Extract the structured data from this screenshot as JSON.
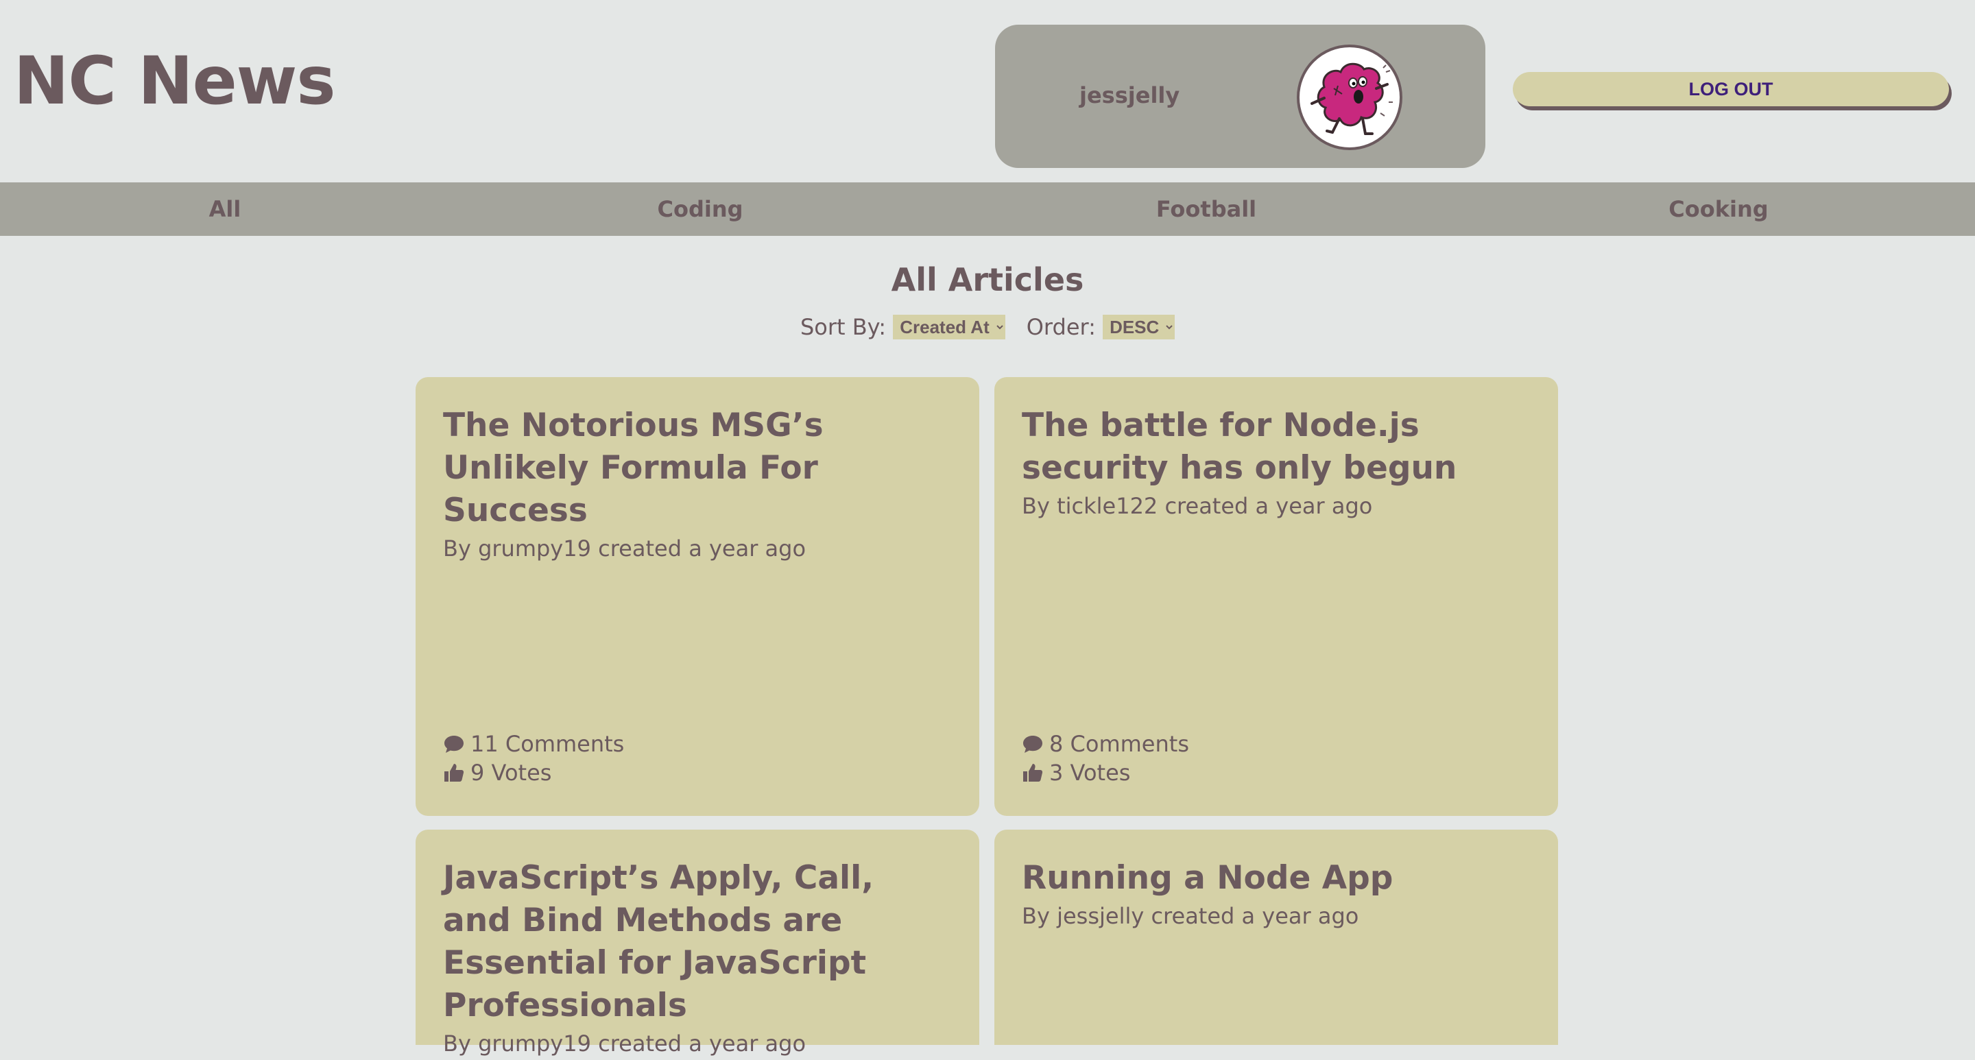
{
  "header": {
    "title": "NC News",
    "username": "jessjelly",
    "avatar_icon": "pink-monster-avatar-icon",
    "logout_label": "LOG OUT"
  },
  "nav": {
    "items": [
      {
        "label": "All"
      },
      {
        "label": "Coding"
      },
      {
        "label": "Football"
      },
      {
        "label": "Cooking"
      }
    ]
  },
  "main": {
    "heading": "All Articles",
    "sort_label": "Sort By:",
    "sort_value": "Created At",
    "order_label": "Order:",
    "order_value": "DESC"
  },
  "articles": [
    {
      "title": "The Notorious MSG’s Unlikely Formula For Success",
      "meta": "By grumpy19 created a year ago",
      "comments": "11 Comments",
      "votes": "9 Votes"
    },
    {
      "title": "The battle for Node.js security has only begun",
      "meta": "By tickle122 created a year ago",
      "comments": "8 Comments",
      "votes": "3 Votes"
    },
    {
      "title": "JavaScript’s Apply, Call, and Bind Methods are Essential for JavaScript Professionals",
      "meta": "By grumpy19 created a year ago"
    },
    {
      "title": "Running a Node App",
      "meta": "By jessjelly created a year ago"
    }
  ],
  "colors": {
    "background": "#e4e7e6",
    "panel": "#a4a49c",
    "card": "#d5d1a7",
    "text": "#6b5a5e",
    "button_text": "#3e1f7a",
    "avatar_pink": "#c8287e"
  }
}
